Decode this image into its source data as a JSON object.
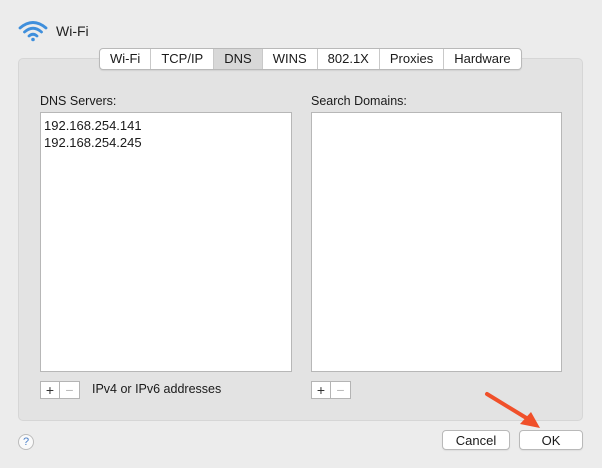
{
  "window": {
    "title": "Wi-Fi"
  },
  "tabs": [
    {
      "label": "Wi-Fi",
      "active": false
    },
    {
      "label": "TCP/IP",
      "active": false
    },
    {
      "label": "DNS",
      "active": true
    },
    {
      "label": "WINS",
      "active": false
    },
    {
      "label": "802.1X",
      "active": false
    },
    {
      "label": "Proxies",
      "active": false
    },
    {
      "label": "Hardware",
      "active": false
    }
  ],
  "dns": {
    "label": "DNS Servers:",
    "servers": [
      "192.168.254.141",
      "192.168.254.245"
    ],
    "hint": "IPv4 or IPv6 addresses"
  },
  "search": {
    "label": "Search Domains:",
    "domains": []
  },
  "controls": {
    "add": "+",
    "remove": "−"
  },
  "buttons": {
    "help": "?",
    "cancel": "Cancel",
    "ok": "OK"
  },
  "colors": {
    "accent": "#3f8fdc",
    "annotation_arrow": "#f0502a"
  },
  "icons": {
    "window": "wifi-icon",
    "annotation": "red-arrow-icon"
  }
}
